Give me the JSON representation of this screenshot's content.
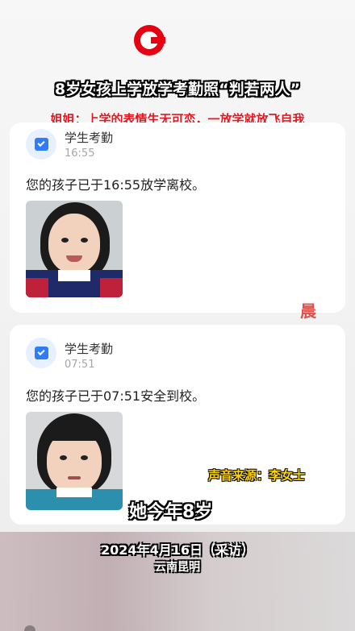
{
  "headline": "8岁女孩上学放学考勤照“判若两人”",
  "subhead": "姐姐：上学的表情生无可恋，一放学就放飞自我",
  "cards": [
    {
      "title": "学生考勤",
      "time": "16:55",
      "message": "您的孩子已于16:55放学离校。"
    },
    {
      "title": "学生考勤",
      "time": "07:51",
      "message": "您的孩子已于07:51安全到校。"
    }
  ],
  "watermark": "晨",
  "captions": {
    "source": "声音来源：李女士",
    "age": "她今年8岁",
    "date": "2024年4月16日（采访）",
    "place": "云南昆明"
  },
  "colors": {
    "brand_red": "#e60012",
    "subhead_red": "#e8141e",
    "caption_yellow": "#ffd400",
    "app_blue": "#2f7df6"
  },
  "icons": {
    "logo": "c-logo-icon",
    "app": "calendar-check-icon"
  }
}
